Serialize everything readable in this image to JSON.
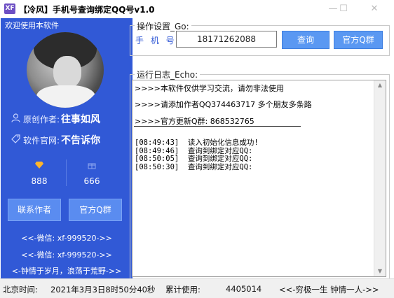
{
  "window": {
    "icon_text": "XF",
    "title": "【冷风】手机号查询绑定QQ号v1.0",
    "minimize": "—",
    "maximize": "☐",
    "close": "✕"
  },
  "sidebar": {
    "welcome": "欢迎使用本软件",
    "author_label": "原创作者:",
    "author_value": "往事如风",
    "site_label": "软件官网:",
    "site_value": "不告诉你",
    "stats": [
      {
        "icon": "diamond-icon",
        "value": "888"
      },
      {
        "icon": "gift-icon",
        "value": "666"
      }
    ],
    "buttons": {
      "contact": "联系作者",
      "group": "官方Q群"
    },
    "lines": [
      "<<-微信: xf-999520->>",
      "<<-微信: xf-999520->>",
      "<-钟情于岁月，浪荡于荒野->>"
    ]
  },
  "settings": {
    "group_label": "操作设置_Go:",
    "phone_label": "手 机 号:",
    "phone_value": "18171262088",
    "query_button": "查询",
    "group_button": "官方Q群"
  },
  "log": {
    "group_label": "运行日志_Echo:",
    "lines": [
      ">>>>本软件仅供学习交流，请勿非法使用",
      ">>>>请添加作者QQ374463717 多个朋友多条路",
      ">>>>官方更新Q群: 868532765"
    ],
    "entries": [
      {
        "time": "[08:49:43]",
        "message": "读入初始化信息成功!"
      },
      {
        "time": "[08:49:46]",
        "message": "查询到绑定对应QQ:"
      },
      {
        "time": "[08:50:05]",
        "message": "查询到绑定对应QQ:"
      },
      {
        "time": "[08:50:30]",
        "message": "查询到绑定对应QQ:"
      }
    ]
  },
  "status": {
    "time_label": "北京时间:",
    "time_value": "2021年3月3日8时50分40秒",
    "usage_label": "累计使用:",
    "usage_value": "4405014",
    "slogan": "<<-穷极一生 钟情一人->>"
  }
}
